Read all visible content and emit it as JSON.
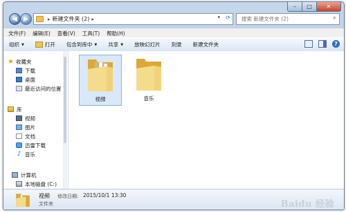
{
  "window": {
    "address": {
      "path": "新建文件夹 (2)"
    },
    "search": {
      "placeholder": "搜索 新建文件夹 (2)"
    }
  },
  "menubar": [
    {
      "label": "文件(F)"
    },
    {
      "label": "编辑(E)"
    },
    {
      "label": "查看(V)"
    },
    {
      "label": "工具(T)"
    },
    {
      "label": "帮助(H)"
    }
  ],
  "toolbar": {
    "organize": "组织",
    "open": "打开",
    "include": "包含到库中",
    "share": "共享",
    "slideshow": "放映幻灯片",
    "burn": "刻录",
    "new_folder": "新建文件夹"
  },
  "nav": {
    "favorites": "收藏夹",
    "downloads": "下载",
    "desktop": "桌面",
    "recent": "最近访问的位置",
    "libraries": "库",
    "videos": "视频",
    "pictures": "图片",
    "documents": "文档",
    "thunder": "迅雷下载",
    "music": "音乐",
    "computer": "计算机",
    "local_disk": "本地磁盘 (C:)"
  },
  "files": [
    {
      "name": "视频",
      "selected": true
    },
    {
      "name": "音乐",
      "selected": false
    }
  ],
  "details": {
    "name": "视频",
    "modified_label": "修改日期:",
    "modified": "2015/10/1 13:30",
    "type": "文件夹"
  },
  "watermark": "Baidu 经验",
  "colors": {
    "selection": "#d9e8fb",
    "folder": "#e9c55c",
    "frame": "#b3c9e2"
  }
}
